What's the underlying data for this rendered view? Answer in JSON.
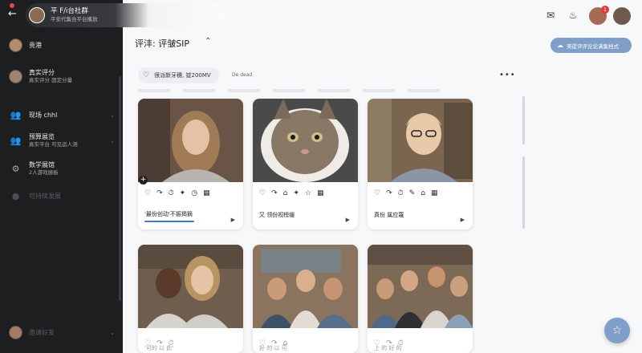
{
  "app": {
    "title": "平 F/i台社群",
    "subtitle": "平安代集合平台播放"
  },
  "sidebar": {
    "items": [
      {
        "label": "贵港",
        "sub": ""
      },
      {
        "label": "真实评分",
        "sub": "真实评分    固定分量"
      },
      {
        "label": "现场 chhl",
        "sub": ""
      },
      {
        "label": "预算展览",
        "sub": "真实平台  可见运人测"
      },
      {
        "label": "数学展馆",
        "sub": "2人游戏展板"
      },
      {
        "label": "可持续发展",
        "sub": ""
      },
      {
        "label": "邀请好友",
        "sub": ""
      }
    ]
  },
  "header": {
    "page_title": "评沣:  评皱SIP",
    "action_button": "美提评评论论满集档式"
  },
  "filter": {
    "chip_label": "很派新牙穗,  锭200MV",
    "chip_extra": "De dead"
  },
  "cards": [
    {
      "caption": "'最份创动'不振揭摘"
    },
    {
      "caption": "又 领份视榜缓"
    },
    {
      "caption": "真份 属应蔑"
    },
    {
      "caption": "'可的 以 此'"
    },
    {
      "caption": "好 的 以 可"
    },
    {
      "caption": "上 的 好 的"
    }
  ],
  "topbar": {
    "notification_count": "1"
  },
  "colors": {
    "sidebar_bg": "#1d1e20",
    "accent": "#7f9ec8",
    "badge": "#e03a3a"
  }
}
